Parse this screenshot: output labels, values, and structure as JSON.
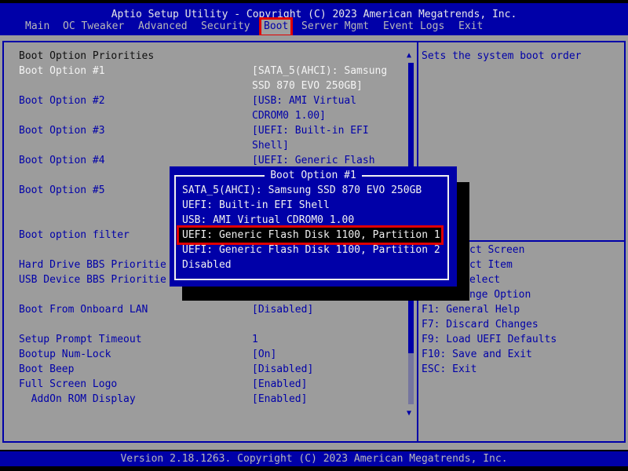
{
  "header": {
    "title": "Aptio Setup Utility - Copyright (C) 2023 American Megatrends, Inc.",
    "tabs": [
      {
        "label": "Main"
      },
      {
        "label": "OC Tweaker"
      },
      {
        "label": "Advanced"
      },
      {
        "label": "Security"
      },
      {
        "label": "Boot",
        "active": true
      },
      {
        "label": "Server Mgmt"
      },
      {
        "label": "Event Logs"
      },
      {
        "label": "Exit"
      }
    ]
  },
  "settings": [
    {
      "label": "Boot Option Priorities",
      "value": "",
      "type": "heading"
    },
    {
      "label": "Boot Option #1",
      "value": "[SATA_5(AHCI): Samsung",
      "value2": "SSD 870 EVO 250GB]",
      "selected": true
    },
    {
      "label": "Boot Option #2",
      "value": "[USB: AMI Virtual",
      "value2": "CDROM0 1.00]"
    },
    {
      "label": "Boot Option #3",
      "value": "[UEFI: Built-in EFI",
      "value2": "Shell]"
    },
    {
      "label": "Boot Option #4",
      "value": "[UEFI: Generic Flash"
    },
    {
      "label": "Boot Option #5",
      "value": ""
    },
    {
      "label": "Boot option filter",
      "value": ""
    },
    {
      "label": "Hard Drive BBS Prioritie",
      "value": ""
    },
    {
      "label": "USB Device BBS Prioritie",
      "value": ""
    },
    {
      "label": "Boot From Onboard LAN",
      "value": "[Disabled]"
    },
    {
      "label": "Setup Prompt Timeout",
      "value": "1"
    },
    {
      "label": "Bootup Num-Lock",
      "value": "[On]"
    },
    {
      "label": "Boot Beep",
      "value": "[Disabled]"
    },
    {
      "label": "Full Screen Logo",
      "value": "[Enabled]"
    },
    {
      "label": "  AddOn ROM Display",
      "value": "[Enabled]"
    }
  ],
  "help": {
    "description": "Sets the system boot order",
    "keys_partial": [
      "ct Screen",
      "ct Item",
      "elect",
      "nge Option"
    ],
    "keys": [
      "F1: General Help",
      "F7: Discard Changes",
      "F9: Load UEFI Defaults",
      "F10: Save and Exit",
      "ESC: Exit"
    ]
  },
  "popup": {
    "title": "Boot Option #1",
    "options": [
      "SATA_5(AHCI): Samsung SSD 870 EVO 250GB",
      "UEFI: Built-in EFI Shell",
      "USB: AMI Virtual CDROM0 1.00",
      "UEFI: Generic Flash Disk 1100, Partition 1",
      "UEFI: Generic Flash Disk 1100, Partition 2",
      "Disabled"
    ],
    "selected_index": 3
  },
  "footer": {
    "text": "Version 2.18.1263. Copyright (C) 2023 American Megatrends, Inc."
  },
  "colors": {
    "header_bg": "#0000a8",
    "body_bg": "#9c9c9c",
    "highlight": "#e00000",
    "text_blue": "#0000a8"
  }
}
